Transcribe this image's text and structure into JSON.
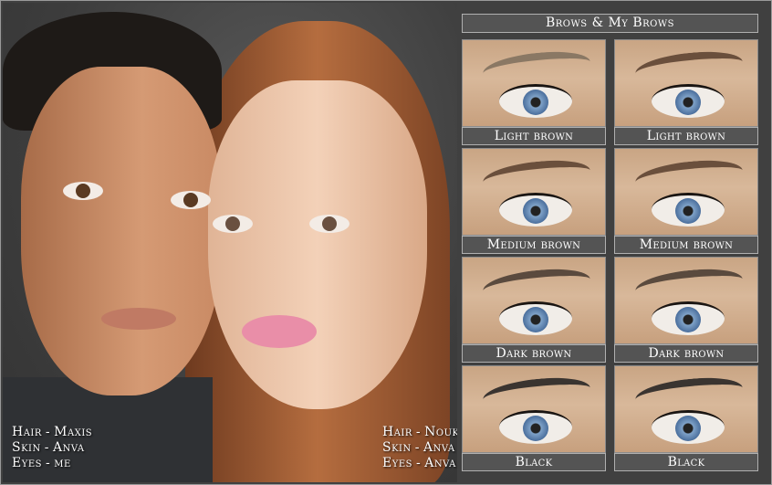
{
  "title": "Brows & My Brows",
  "credits_left": [
    {
      "key": "Hair",
      "value": "Maxis"
    },
    {
      "key": "Skin",
      "value": "Anva"
    },
    {
      "key": "Eyes",
      "value": "me"
    }
  ],
  "credits_right": [
    {
      "key": "Hair",
      "value": "Nouk"
    },
    {
      "key": "Skin",
      "value": "Anva"
    },
    {
      "key": "Eyes",
      "value": "Anva"
    }
  ],
  "swatches": [
    {
      "label": "Light brown"
    },
    {
      "label": "Light brown"
    },
    {
      "label": "Medium brown"
    },
    {
      "label": "Medium brown"
    },
    {
      "label": "Dark brown"
    },
    {
      "label": "Dark brown"
    },
    {
      "label": "Black"
    },
    {
      "label": "Black"
    }
  ],
  "colors": {
    "panel_bg": "#545454",
    "panel_border": "#b0b0b0",
    "text": "#ffffff"
  }
}
